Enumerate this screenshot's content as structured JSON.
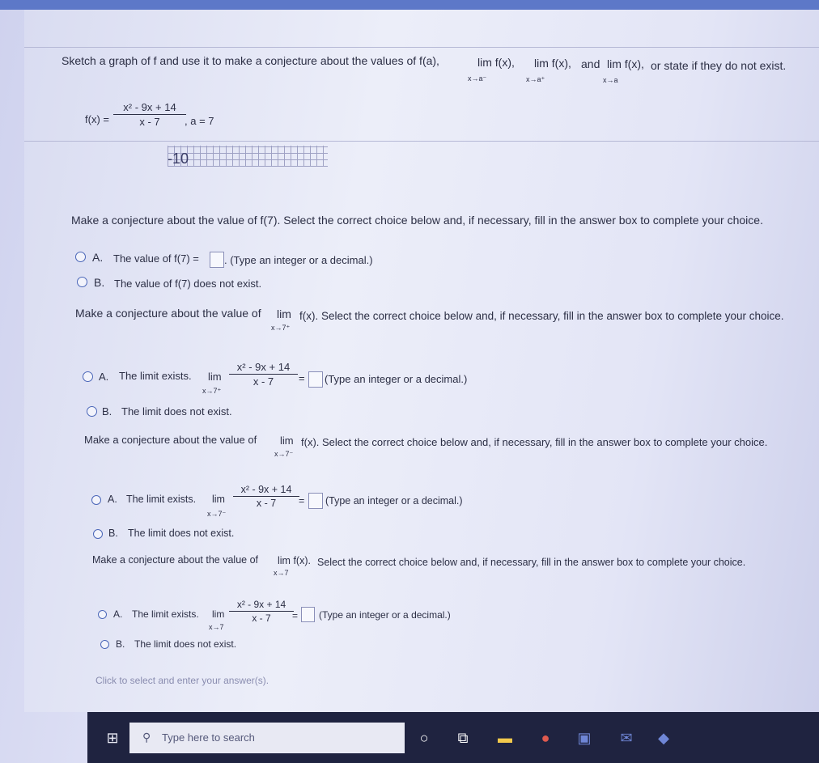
{
  "problem": {
    "instruction": "Sketch a graph of f and use it to make a conjecture about the values of f(a),",
    "lim1": "lim f(x),",
    "lim1_sub": "x→a⁻",
    "lim2": "lim f(x),",
    "lim2_sub": "x→a⁺",
    "and": "and",
    "lim3": "lim f(x),",
    "lim3_sub": "x→a",
    "tail": "or state if they do not exist.",
    "fx": "f(x) =",
    "numerator": "x² - 9x + 14",
    "denominator": "x - 7",
    "a_value": ", a = 7",
    "graph_label": "-10"
  },
  "q1": {
    "prompt": "Make a conjecture about the value of f(7). Select the correct choice below and, if necessary, fill in the answer box to complete your choice.",
    "optA_letter": "A.",
    "optA_text": "The value of f(7) =",
    "optA_hint": ". (Type an integer or a decimal.)",
    "optB_letter": "B.",
    "optB_text": "The value of f(7) does not exist."
  },
  "q2": {
    "prompt_a": "Make a conjecture about the value of",
    "prompt_lim": "lim",
    "prompt_sub": "x→7⁺",
    "prompt_b": "f(x). Select the correct choice below and, if necessary, fill in the answer box to complete your choice.",
    "optA_letter": "A.",
    "optA_text": "The limit exists.",
    "optA_lim": "lim",
    "optA_sub": "x→7⁺",
    "optA_hint": "(Type an integer or a decimal.)",
    "optB_letter": "B.",
    "optB_text": "The limit does not exist."
  },
  "q3": {
    "prompt_a": "Make a conjecture about the value of",
    "prompt_lim": "lim",
    "prompt_sub": "x→7⁻",
    "prompt_b": "f(x). Select the correct choice below and, if necessary, fill in the answer box to complete your choice.",
    "optA_letter": "A.",
    "optA_text": "The limit exists.",
    "optA_lim": "lim",
    "optA_sub": "x→7⁻",
    "optA_hint": "(Type an integer or a decimal.)",
    "optB_letter": "B.",
    "optB_text": "The limit does not exist."
  },
  "q4": {
    "prompt_a": "Make a conjecture about the value of",
    "prompt_lim": "lim f(x).",
    "prompt_sub": "x→7",
    "prompt_b": "Select the correct choice below and, if necessary, fill in the answer box to complete your choice.",
    "optA_letter": "A.",
    "optA_text": "The limit exists.",
    "optA_lim": "lim",
    "optA_sub": "x→7",
    "optA_hint": "(Type an integer or a decimal.)",
    "optB_letter": "B.",
    "optB_text": "The limit does not exist."
  },
  "footer_hint": "Click to select and enter your answer(s).",
  "taskbar": {
    "search_placeholder": "Type here to search"
  },
  "colors": {
    "radio": "#4a66b8",
    "taskbar": "#1f2340",
    "text": "#2c2f45"
  }
}
